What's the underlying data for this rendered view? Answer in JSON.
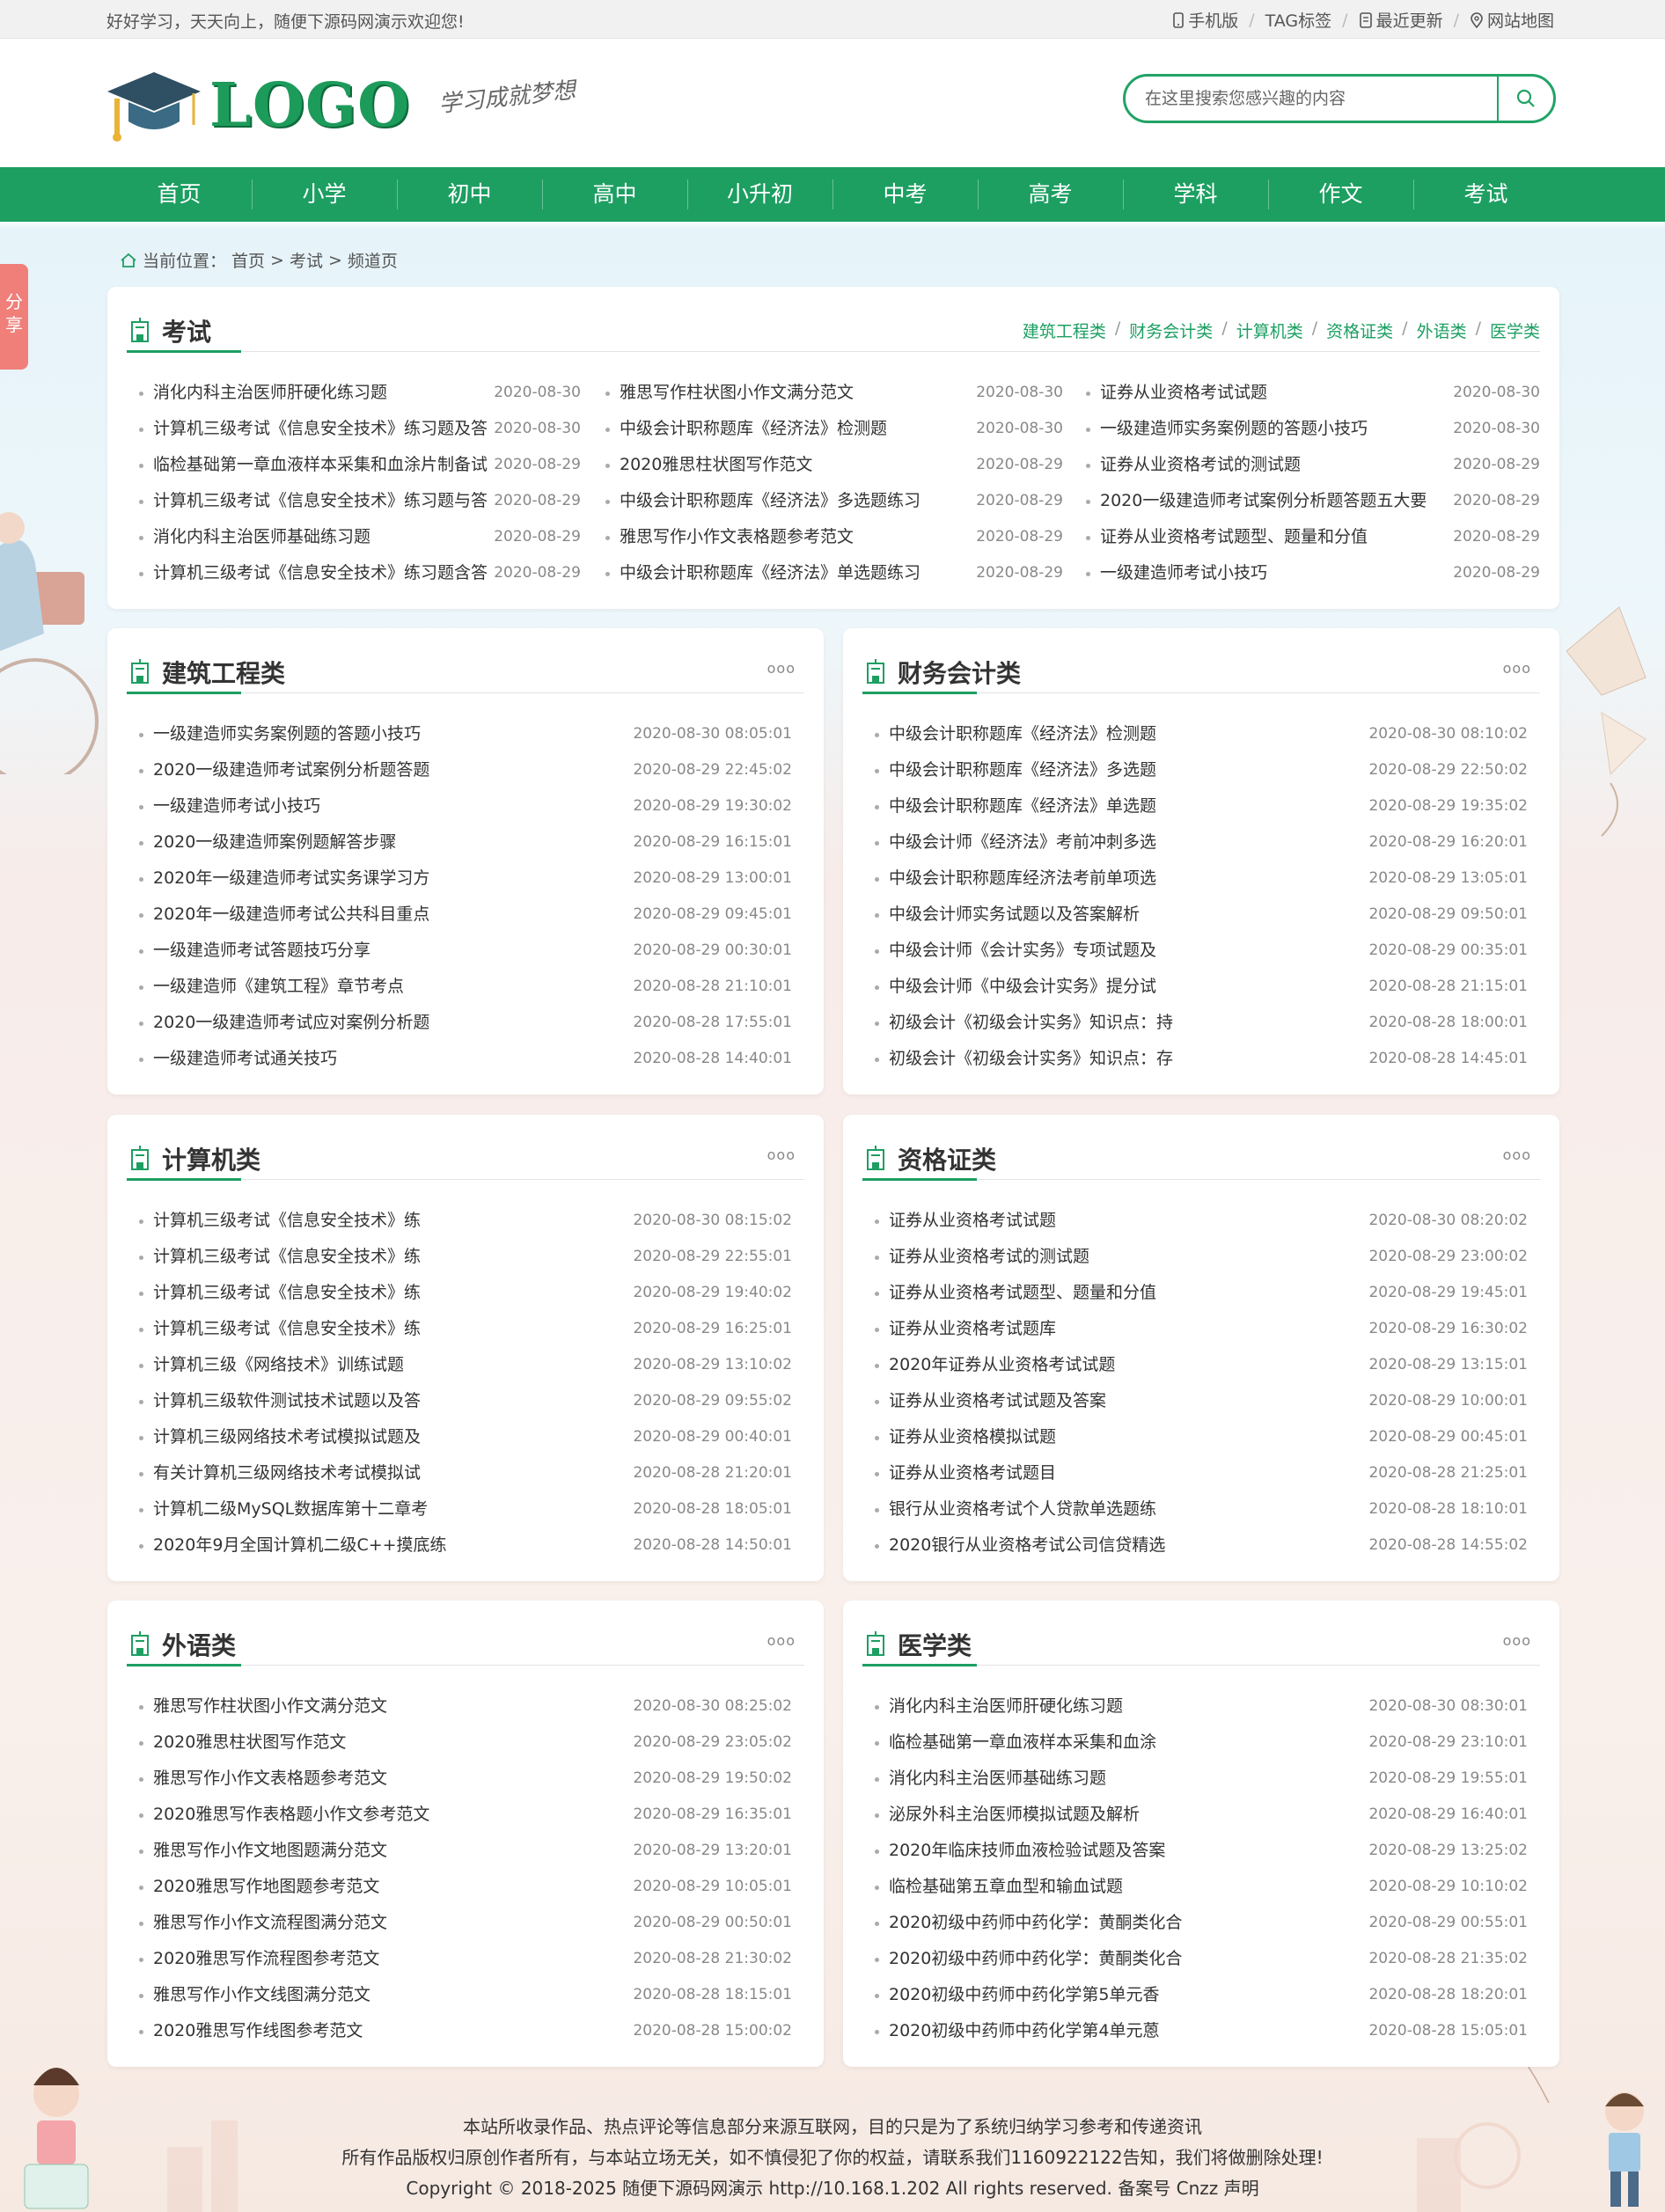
{
  "topbar": {
    "welcome": "好好学习，天天向上，随便下源码网演示欢迎您!",
    "links": [
      {
        "label": "手机版"
      },
      {
        "label": "TAG标签"
      },
      {
        "label": "最近更新"
      },
      {
        "label": "网站地图"
      }
    ]
  },
  "header": {
    "logo_text": "LOGO",
    "slogan": "学习成就梦想",
    "search_placeholder": "在这里搜索您感兴趣的内容"
  },
  "nav": [
    "首页",
    "小学",
    "初中",
    "高中",
    "小升初",
    "中考",
    "高考",
    "学科",
    "作文",
    "考试"
  ],
  "breadcrumb": {
    "prefix": "当前位置：",
    "items": [
      "首页",
      "考试",
      "频道页"
    ],
    "sep": " > "
  },
  "share": {
    "label": "分享"
  },
  "exam": {
    "title": "考试",
    "subcats": [
      "建筑工程类",
      "财务会计类",
      "计算机类",
      "资格证类",
      "外语类",
      "医学类"
    ],
    "columns": [
      [
        {
          "t": "消化内科主治医师肝硬化练习题",
          "d": "2020-08-30"
        },
        {
          "t": "计算机三级考试《信息安全技术》练习题及答",
          "d": "2020-08-30"
        },
        {
          "t": "临检基础第一章血液样本采集和血涂片制备试",
          "d": "2020-08-29"
        },
        {
          "t": "计算机三级考试《信息安全技术》练习题与答",
          "d": "2020-08-29"
        },
        {
          "t": "消化内科主治医师基础练习题",
          "d": "2020-08-29"
        },
        {
          "t": "计算机三级考试《信息安全技术》练习题含答",
          "d": "2020-08-29"
        }
      ],
      [
        {
          "t": "雅思写作柱状图小作文满分范文",
          "d": "2020-08-30"
        },
        {
          "t": "中级会计职称题库《经济法》检测题",
          "d": "2020-08-30"
        },
        {
          "t": "2020雅思柱状图写作范文",
          "d": "2020-08-29"
        },
        {
          "t": "中级会计职称题库《经济法》多选题练习",
          "d": "2020-08-29"
        },
        {
          "t": "雅思写作小作文表格题参考范文",
          "d": "2020-08-29"
        },
        {
          "t": "中级会计职称题库《经济法》单选题练习",
          "d": "2020-08-29"
        }
      ],
      [
        {
          "t": "证券从业资格考试试题",
          "d": "2020-08-30"
        },
        {
          "t": "一级建造师实务案例题的答题小技巧",
          "d": "2020-08-30"
        },
        {
          "t": "证券从业资格考试的测试题",
          "d": "2020-08-29"
        },
        {
          "t": "2020一级建造师考试案例分析题答题五大要",
          "d": "2020-08-29"
        },
        {
          "t": "证券从业资格考试题型、题量和分值",
          "d": "2020-08-29"
        },
        {
          "t": "一级建造师考试小技巧",
          "d": "2020-08-29"
        }
      ]
    ]
  },
  "boxes": [
    {
      "title": "建筑工程类",
      "more": "ooo",
      "items": [
        {
          "t": "一级建造师实务案例题的答题小技巧",
          "d": "2020-08-30 08:05:01"
        },
        {
          "t": "2020一级建造师考试案例分析题答题",
          "d": "2020-08-29 22:45:02"
        },
        {
          "t": "一级建造师考试小技巧",
          "d": "2020-08-29 19:30:02"
        },
        {
          "t": "2020一级建造师案例题解答步骤",
          "d": "2020-08-29 16:15:01"
        },
        {
          "t": "2020年一级建造师考试实务课学习方",
          "d": "2020-08-29 13:00:01"
        },
        {
          "t": "2020年一级建造师考试公共科目重点",
          "d": "2020-08-29 09:45:01"
        },
        {
          "t": "一级建造师考试答题技巧分享",
          "d": "2020-08-29 00:30:01"
        },
        {
          "t": "一级建造师《建筑工程》章节考点",
          "d": "2020-08-28 21:10:01"
        },
        {
          "t": "2020一级建造师考试应对案例分析题",
          "d": "2020-08-28 17:55:01"
        },
        {
          "t": "一级建造师考试通关技巧",
          "d": "2020-08-28 14:40:01"
        }
      ]
    },
    {
      "title": "财务会计类",
      "more": "ooo",
      "items": [
        {
          "t": "中级会计职称题库《经济法》检测题",
          "d": "2020-08-30 08:10:02"
        },
        {
          "t": "中级会计职称题库《经济法》多选题",
          "d": "2020-08-29 22:50:02"
        },
        {
          "t": "中级会计职称题库《经济法》单选题",
          "d": "2020-08-29 19:35:02"
        },
        {
          "t": "中级会计师《经济法》考前冲刺多选",
          "d": "2020-08-29 16:20:01"
        },
        {
          "t": "中级会计职称题库经济法考前单项选",
          "d": "2020-08-29 13:05:01"
        },
        {
          "t": "中级会计师实务试题以及答案解析",
          "d": "2020-08-29 09:50:01"
        },
        {
          "t": "中级会计师《会计实务》专项试题及",
          "d": "2020-08-29 00:35:01"
        },
        {
          "t": "中级会计师《中级会计实务》提分试",
          "d": "2020-08-28 21:15:01"
        },
        {
          "t": "初级会计《初级会计实务》知识点：持",
          "d": "2020-08-28 18:00:01"
        },
        {
          "t": "初级会计《初级会计实务》知识点：存",
          "d": "2020-08-28 14:45:01"
        }
      ]
    },
    {
      "title": "计算机类",
      "more": "ooo",
      "items": [
        {
          "t": "计算机三级考试《信息安全技术》练",
          "d": "2020-08-30 08:15:02"
        },
        {
          "t": "计算机三级考试《信息安全技术》练",
          "d": "2020-08-29 22:55:01"
        },
        {
          "t": "计算机三级考试《信息安全技术》练",
          "d": "2020-08-29 19:40:02"
        },
        {
          "t": "计算机三级考试《信息安全技术》练",
          "d": "2020-08-29 16:25:01"
        },
        {
          "t": "计算机三级《网络技术》训练试题",
          "d": "2020-08-29 13:10:02"
        },
        {
          "t": "计算机三级软件测试技术试题以及答",
          "d": "2020-08-29 09:55:02"
        },
        {
          "t": "计算机三级网络技术考试模拟试题及",
          "d": "2020-08-29 00:40:01"
        },
        {
          "t": "有关计算机三级网络技术考试模拟试",
          "d": "2020-08-28 21:20:01"
        },
        {
          "t": "计算机二级MySQL数据库第十二章考",
          "d": "2020-08-28 18:05:01"
        },
        {
          "t": "2020年9月全国计算机二级C++摸底练",
          "d": "2020-08-28 14:50:01"
        }
      ]
    },
    {
      "title": "资格证类",
      "more": "ooo",
      "items": [
        {
          "t": "证券从业资格考试试题",
          "d": "2020-08-30 08:20:02"
        },
        {
          "t": "证券从业资格考试的测试题",
          "d": "2020-08-29 23:00:02"
        },
        {
          "t": "证券从业资格考试题型、题量和分值",
          "d": "2020-08-29 19:45:01"
        },
        {
          "t": "证券从业资格考试题库",
          "d": "2020-08-29 16:30:02"
        },
        {
          "t": "2020年证券从业资格考试试题",
          "d": "2020-08-29 13:15:01"
        },
        {
          "t": "证券从业资格考试试题及答案",
          "d": "2020-08-29 10:00:01"
        },
        {
          "t": "证券从业资格模拟试题",
          "d": "2020-08-29 00:45:01"
        },
        {
          "t": "证券从业资格考试题目",
          "d": "2020-08-28 21:25:01"
        },
        {
          "t": "银行从业资格考试个人贷款单选题练",
          "d": "2020-08-28 18:10:01"
        },
        {
          "t": "2020银行从业资格考试公司信贷精选",
          "d": "2020-08-28 14:55:02"
        }
      ]
    },
    {
      "title": "外语类",
      "more": "ooo",
      "items": [
        {
          "t": "雅思写作柱状图小作文满分范文",
          "d": "2020-08-30 08:25:02"
        },
        {
          "t": "2020雅思柱状图写作范文",
          "d": "2020-08-29 23:05:02"
        },
        {
          "t": "雅思写作小作文表格题参考范文",
          "d": "2020-08-29 19:50:02"
        },
        {
          "t": "2020雅思写作表格题小作文参考范文",
          "d": "2020-08-29 16:35:01"
        },
        {
          "t": "雅思写作小作文地图题满分范文",
          "d": "2020-08-29 13:20:01"
        },
        {
          "t": "2020雅思写作地图题参考范文",
          "d": "2020-08-29 10:05:01"
        },
        {
          "t": "雅思写作小作文流程图满分范文",
          "d": "2020-08-29 00:50:01"
        },
        {
          "t": "2020雅思写作流程图参考范文",
          "d": "2020-08-28 21:30:02"
        },
        {
          "t": "雅思写作小作文线图满分范文",
          "d": "2020-08-28 18:15:01"
        },
        {
          "t": "2020雅思写作线图参考范文",
          "d": "2020-08-28 15:00:02"
        }
      ]
    },
    {
      "title": "医学类",
      "more": "ooo",
      "items": [
        {
          "t": "消化内科主治医师肝硬化练习题",
          "d": "2020-08-30 08:30:01"
        },
        {
          "t": "临检基础第一章血液样本采集和血涂",
          "d": "2020-08-29 23:10:01"
        },
        {
          "t": "消化内科主治医师基础练习题",
          "d": "2020-08-29 19:55:01"
        },
        {
          "t": "泌尿外科主治医师模拟试题及解析",
          "d": "2020-08-29 16:40:01"
        },
        {
          "t": "2020年临床技师血液检验试题及答案",
          "d": "2020-08-29 13:25:02"
        },
        {
          "t": "临检基础第五章血型和输血试题",
          "d": "2020-08-29 10:10:02"
        },
        {
          "t": "2020初级中药师中药化学：黄酮类化合",
          "d": "2020-08-29 00:55:01"
        },
        {
          "t": "2020初级中药师中药化学：黄酮类化合",
          "d": "2020-08-28 21:35:02"
        },
        {
          "t": "2020初级中药师中药化学第5单元香",
          "d": "2020-08-28 18:20:01"
        },
        {
          "t": "2020初级中药师中药化学第4单元蒽",
          "d": "2020-08-28 15:05:01"
        }
      ]
    }
  ],
  "footer": {
    "line1": "本站所收录作品、热点评论等信息部分来源互联网，目的只是为了系统归纳学习参考和传递资讯",
    "line2": "所有作品版权归原创作者所有，与本站立场无关，如不慎侵犯了你的权益，请联系我们1160922122告知，我们将做删除处理!",
    "line3": "Copyright © 2018-2025 随便下源码网演示 http://10.168.1.202 All rights reserved. 备案号 Cnzz 声明"
  },
  "colors": {
    "accent": "#1d9f62",
    "share_tab": "#f07f7a"
  }
}
